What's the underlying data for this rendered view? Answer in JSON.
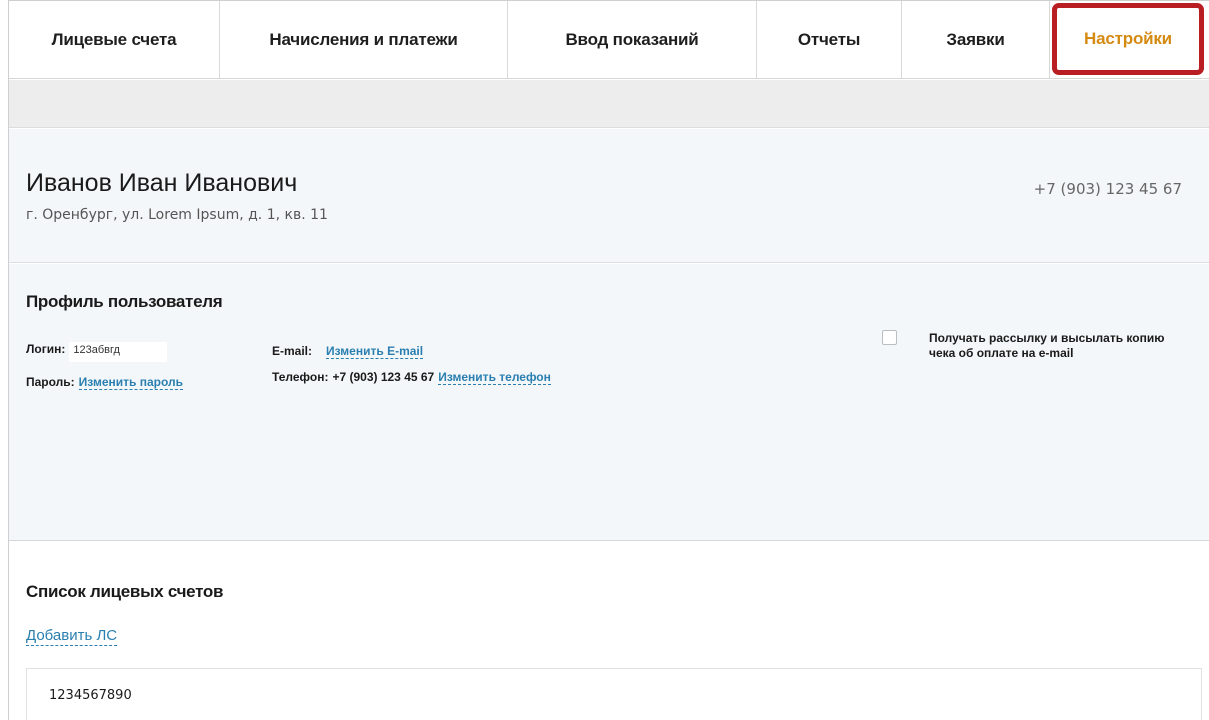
{
  "nav": {
    "tabs": [
      {
        "label": "Лицевые счета"
      },
      {
        "label": "Начисления и платежи"
      },
      {
        "label": "Ввод показаний"
      },
      {
        "label": "Отчеты"
      },
      {
        "label": "Заявки"
      },
      {
        "label": "Настройки",
        "active": true
      }
    ]
  },
  "user": {
    "name": "Иванов Иван Иванович",
    "address": "г. Оренбург, ул. Lorem Ipsum, д. 1, кв. 11",
    "phone": "+7 (903) 123 45 67"
  },
  "profile": {
    "title": "Профиль пользователя",
    "login_label": "Логин:",
    "login_value": "123абвгд",
    "password_label": "Пароль:",
    "change_password_link": "Изменить пароль",
    "email_label": "E-mail:",
    "change_email_link": "Изменить E-mail",
    "phone_label": "Телефон:",
    "phone_value": "+7 (903) 123 45 67",
    "change_phone_link": "Изменить телефон",
    "newsletter_checked": false,
    "newsletter_label": "Получать рассылку и высылать копию чека об оплате на e-mail"
  },
  "accounts": {
    "title": "Список лицевых счетов",
    "add_link": "Добавить ЛС",
    "items": [
      {
        "number": "1234567890"
      }
    ]
  },
  "colors": {
    "active_tab_text": "#d58a12",
    "highlight_border": "#b81e22",
    "link": "#2a7fb0"
  }
}
